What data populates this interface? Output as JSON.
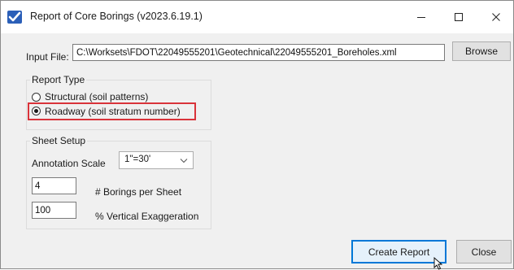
{
  "window": {
    "title": "Report of Core Borings (v2023.6.19.1)"
  },
  "input_file": {
    "label": "Input File:",
    "value": "C:\\Worksets\\FDOT\\22049555201\\Geotechnical\\22049555201_Boreholes.xml",
    "browse_label": "Browse"
  },
  "report_type": {
    "title": "Report Type",
    "options": [
      {
        "label": "Structural (soil patterns)",
        "selected": false
      },
      {
        "label": "Roadway (soil stratum number)",
        "selected": true
      }
    ],
    "highlight_color": "#d9333a"
  },
  "sheet_setup": {
    "title": "Sheet Setup",
    "annotation_scale_label": "Annotation Scale",
    "annotation_scale_value": "1\"=30'",
    "borings_value": "4",
    "borings_label": "# Borings per Sheet",
    "vexag_value": "100",
    "vexag_label": "% Vertical Exaggeration"
  },
  "actions": {
    "create_label": "Create Report",
    "close_label": "Close"
  },
  "colors": {
    "focus_border": "#0078d7",
    "button_face": "#e1e1e1"
  }
}
